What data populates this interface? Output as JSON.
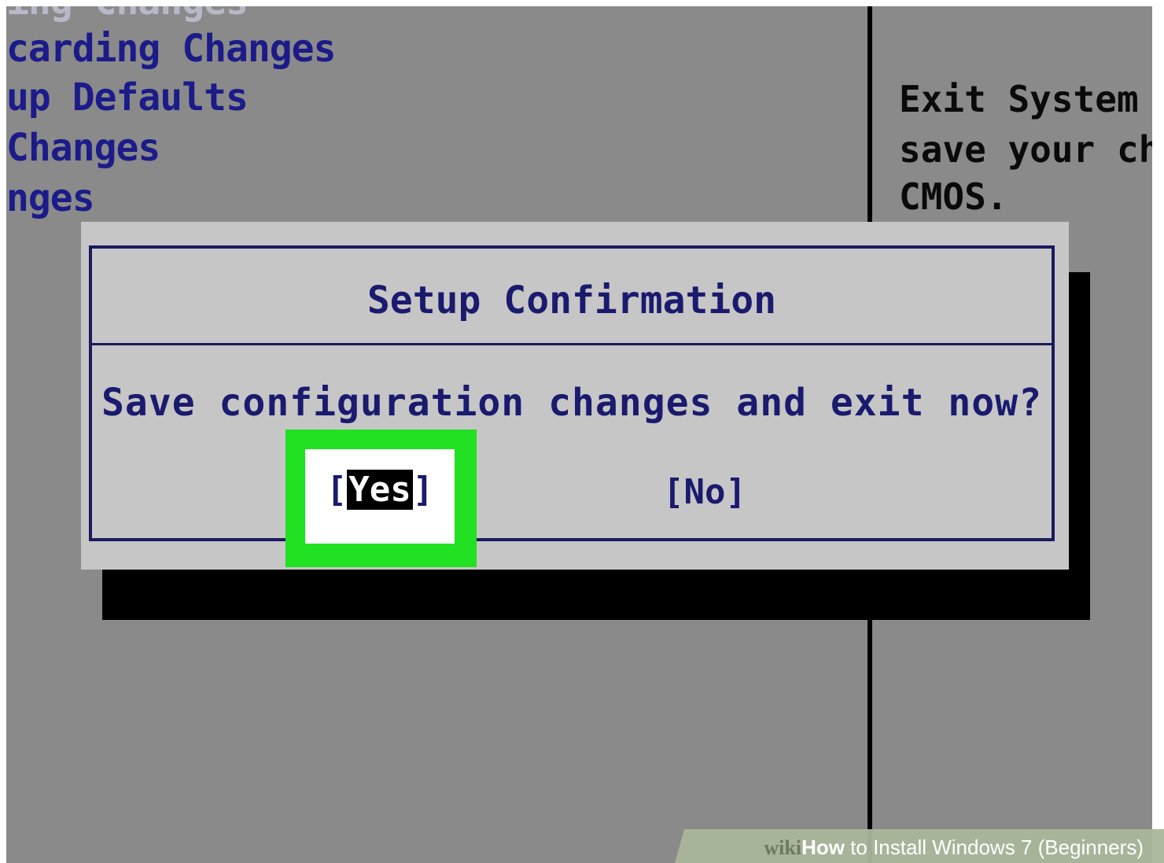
{
  "bios": {
    "menu_items": [
      "ing Changes",
      "carding Changes",
      "up Defaults",
      "Changes",
      "nges"
    ],
    "help_lines": [
      "Exit System",
      "save your ch",
      "CMOS."
    ]
  },
  "dialog": {
    "title": "Setup Confirmation",
    "question": "Save configuration changes and exit now?",
    "yes_left_bracket": "[",
    "yes_label": "Yes",
    "yes_right_bracket": "]",
    "no_label": "[No]"
  },
  "watermark": {
    "wiki": "wiki",
    "how": "How",
    "rest": " to Install Windows 7 (Beginners)"
  },
  "colors": {
    "highlight": "#22e022",
    "background": "#8a8a8a",
    "dialog": "#c6c6c6",
    "text": "#1a1a6e"
  }
}
